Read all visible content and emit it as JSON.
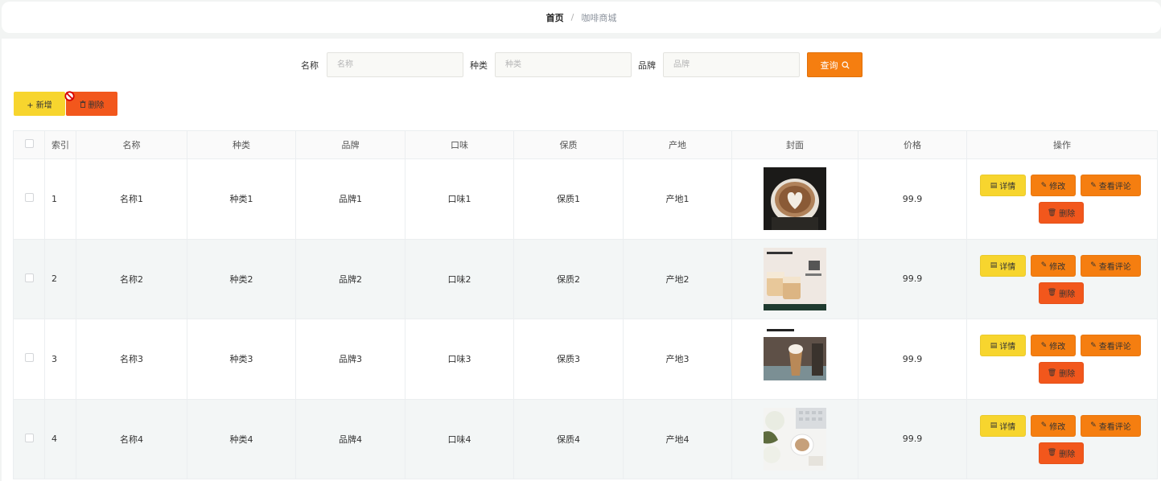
{
  "breadcrumb": {
    "home": "首页",
    "separator": "/",
    "current": "咖啡商城"
  },
  "search": {
    "name_label": "名称",
    "name_placeholder": "名称",
    "type_label": "种类",
    "type_placeholder": "种类",
    "brand_label": "品牌",
    "brand_placeholder": "品牌",
    "query_label": "查询"
  },
  "toolbar": {
    "add_label": "+ 新增",
    "delete_label": "删除"
  },
  "table": {
    "headers": [
      "索引",
      "名称",
      "种类",
      "品牌",
      "口味",
      "保质",
      "产地",
      "封面",
      "价格",
      "操作"
    ],
    "rows": [
      {
        "index": "1",
        "name": "名称1",
        "type": "种类1",
        "brand": "品牌1",
        "flavor": "口味1",
        "shelf": "保质1",
        "origin": "产地1",
        "cover": "latte-art-icon",
        "price": "99.9"
      },
      {
        "index": "2",
        "name": "名称2",
        "type": "种类2",
        "brand": "品牌2",
        "flavor": "口味2",
        "shelf": "保质2",
        "origin": "产地2",
        "cover": "starbucks-cups-icon",
        "price": "99.9"
      },
      {
        "index": "3",
        "name": "名称3",
        "type": "种类3",
        "brand": "品牌3",
        "flavor": "口味3",
        "shelf": "保质3",
        "origin": "产地3",
        "cover": "iced-coffee-icon",
        "price": "99.9"
      },
      {
        "index": "4",
        "name": "名称4",
        "type": "种类4",
        "brand": "品牌4",
        "flavor": "口味4",
        "shelf": "保质4",
        "origin": "产地4",
        "cover": "desk-coffee-icon",
        "price": "99.9"
      }
    ],
    "actions": {
      "detail": "详情",
      "edit": "修改",
      "review": "查看评论",
      "delete": "删除"
    }
  },
  "colors": {
    "yellow": "#f7d52e",
    "orange": "#f57e10",
    "red": "#f2571c"
  }
}
